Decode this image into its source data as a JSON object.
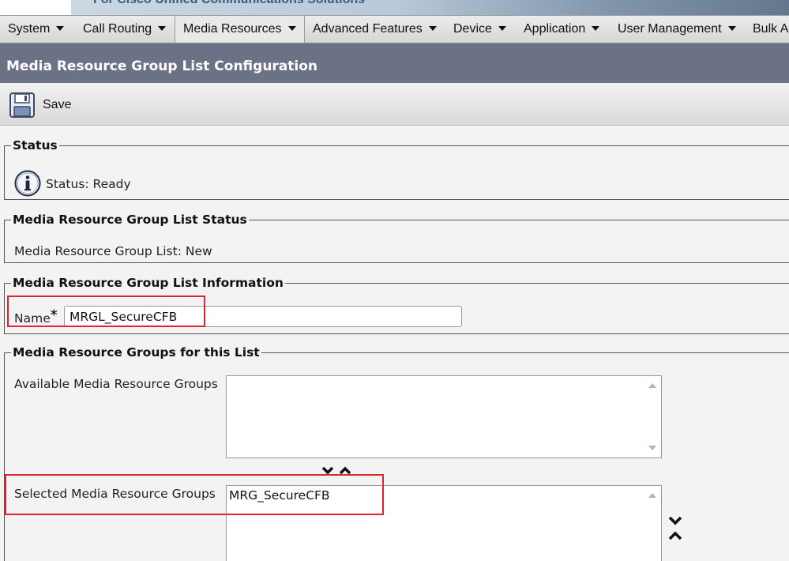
{
  "banner": {
    "tagline": "For Cisco Unified Communications Solutions"
  },
  "menu": {
    "items": [
      {
        "label": "System"
      },
      {
        "label": "Call Routing"
      },
      {
        "label": "Media Resources"
      },
      {
        "label": "Advanced Features"
      },
      {
        "label": "Device"
      },
      {
        "label": "Application"
      },
      {
        "label": "User Management"
      },
      {
        "label": "Bulk Ad"
      }
    ],
    "active": "Media Resources"
  },
  "page": {
    "title": "Media Resource Group List Configuration"
  },
  "toolbar": {
    "save_label": "Save",
    "save_icon": "floppy-disk-icon"
  },
  "status": {
    "legend": "Status",
    "icon": "info-icon",
    "text": "Status: Ready"
  },
  "mrgl_status": {
    "legend": "Media Resource Group List Status",
    "text": "Media Resource Group List: New"
  },
  "info": {
    "legend": "Media Resource Group List Information",
    "name_label": "Name",
    "required_mark": "*",
    "name_value": "MRGL_SecureCFB"
  },
  "groups": {
    "legend": "Media Resource Groups for this List",
    "available_label": "Available Media Resource Groups",
    "available_items": [],
    "selected_label": "Selected Media Resource Groups",
    "selected_items": [
      "MRG_SecureCFB"
    ]
  },
  "colors": {
    "title_bar": "#6b7286",
    "highlight": "#e0242f",
    "banner_text": "#3d5a80"
  }
}
